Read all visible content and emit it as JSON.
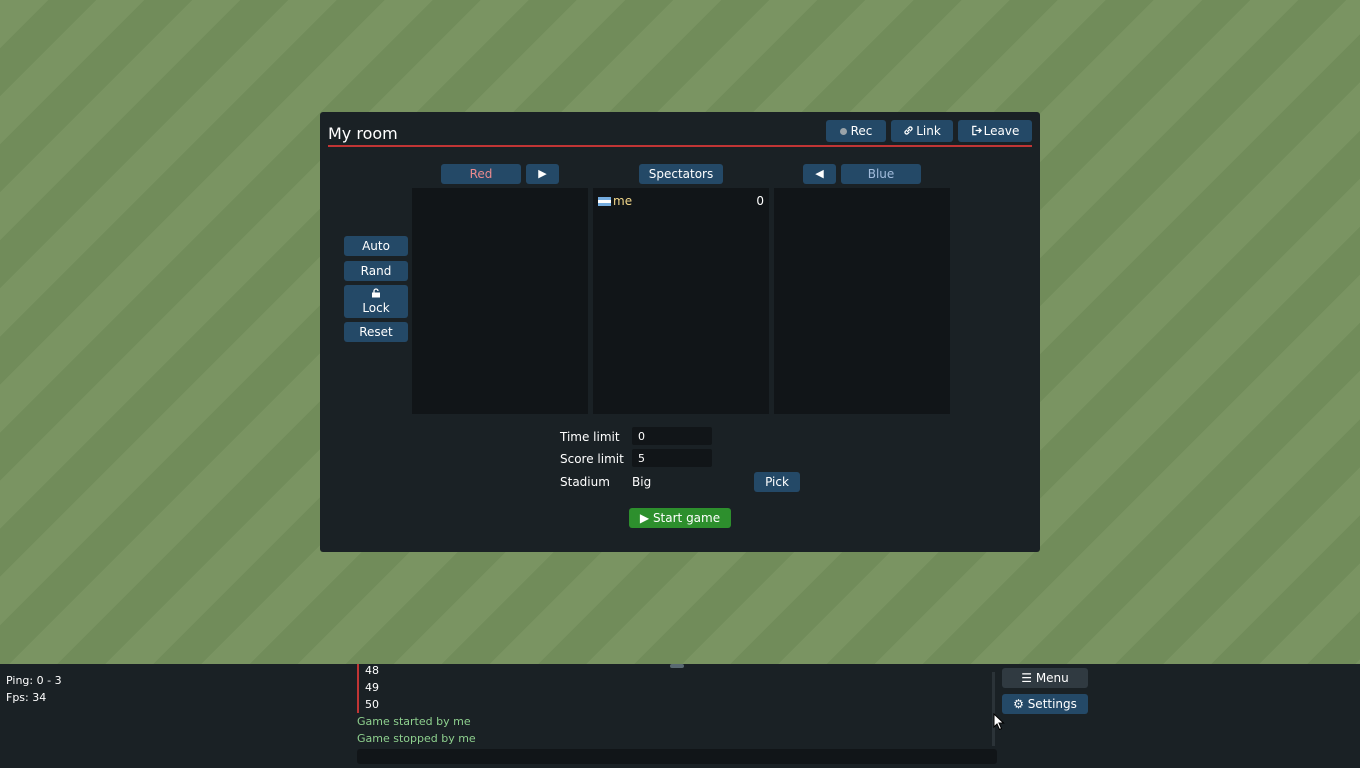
{
  "room": {
    "title": "My room",
    "buttons": {
      "rec": "Rec",
      "link": "Link",
      "leave": "Leave"
    }
  },
  "teams": {
    "red_label": "Red",
    "move_red_arrow": "▶",
    "spectators_label": "Spectators",
    "move_blue_arrow": "◀",
    "blue_label": "Blue",
    "spectators": [
      {
        "name": "me",
        "score": "0",
        "flag": "argentina-flag-icon"
      }
    ]
  },
  "side_buttons": {
    "auto": "Auto",
    "rand": "Rand",
    "lock": "Lock",
    "reset": "Reset"
  },
  "options": {
    "time_limit_label": "Time limit",
    "time_limit_value": "0",
    "score_limit_label": "Score limit",
    "score_limit_value": "5",
    "stadium_label": "Stadium",
    "stadium_value": "Big",
    "pick_label": "Pick",
    "start_label": "Start game"
  },
  "stats": {
    "ping": "Ping: 0 - 3",
    "fps": "Fps: 34"
  },
  "chat": {
    "lines": [
      {
        "text": "48",
        "kind": "number"
      },
      {
        "text": "49",
        "kind": "number"
      },
      {
        "text": "50",
        "kind": "number"
      },
      {
        "text": "Game started by me",
        "kind": "notice"
      },
      {
        "text": "Game stopped by me",
        "kind": "notice"
      }
    ],
    "input_value": ""
  },
  "bottom_buttons": {
    "menu": "Menu",
    "settings": "Settings"
  },
  "colors": {
    "accent_red": "#c13535",
    "button_blue": "#244967",
    "start_green": "#2d8f2d",
    "panel_bg": "#1a2125",
    "notice_green": "#8ed08e"
  }
}
